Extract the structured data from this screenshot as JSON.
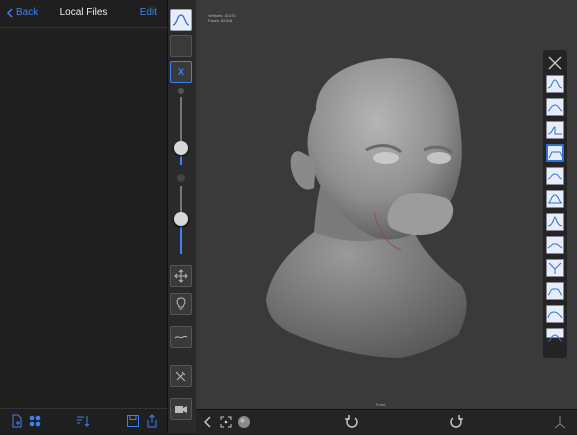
{
  "files_panel": {
    "back_label": "Back",
    "title": "Local Files",
    "edit_label": "Edit"
  },
  "viewport": {
    "stats_vertices": "Vertices: 41372",
    "stats_faces": "Faces: 82416",
    "view_label": "Front"
  },
  "sliders": {
    "radius_level": 0.3,
    "strength_level": 0.33
  },
  "toolbar": {
    "symmetry_label": "X"
  },
  "colors": {
    "accent": "#3b82f6",
    "panel_bg": "#1f1f1f",
    "viewport_bg": "#3a3a3a"
  },
  "brush_palette": [
    "standard",
    "clay",
    "crease",
    "flatten",
    "inflate",
    "layer",
    "pinch",
    "smooth",
    "scrape",
    "move",
    "drag",
    "mask"
  ]
}
